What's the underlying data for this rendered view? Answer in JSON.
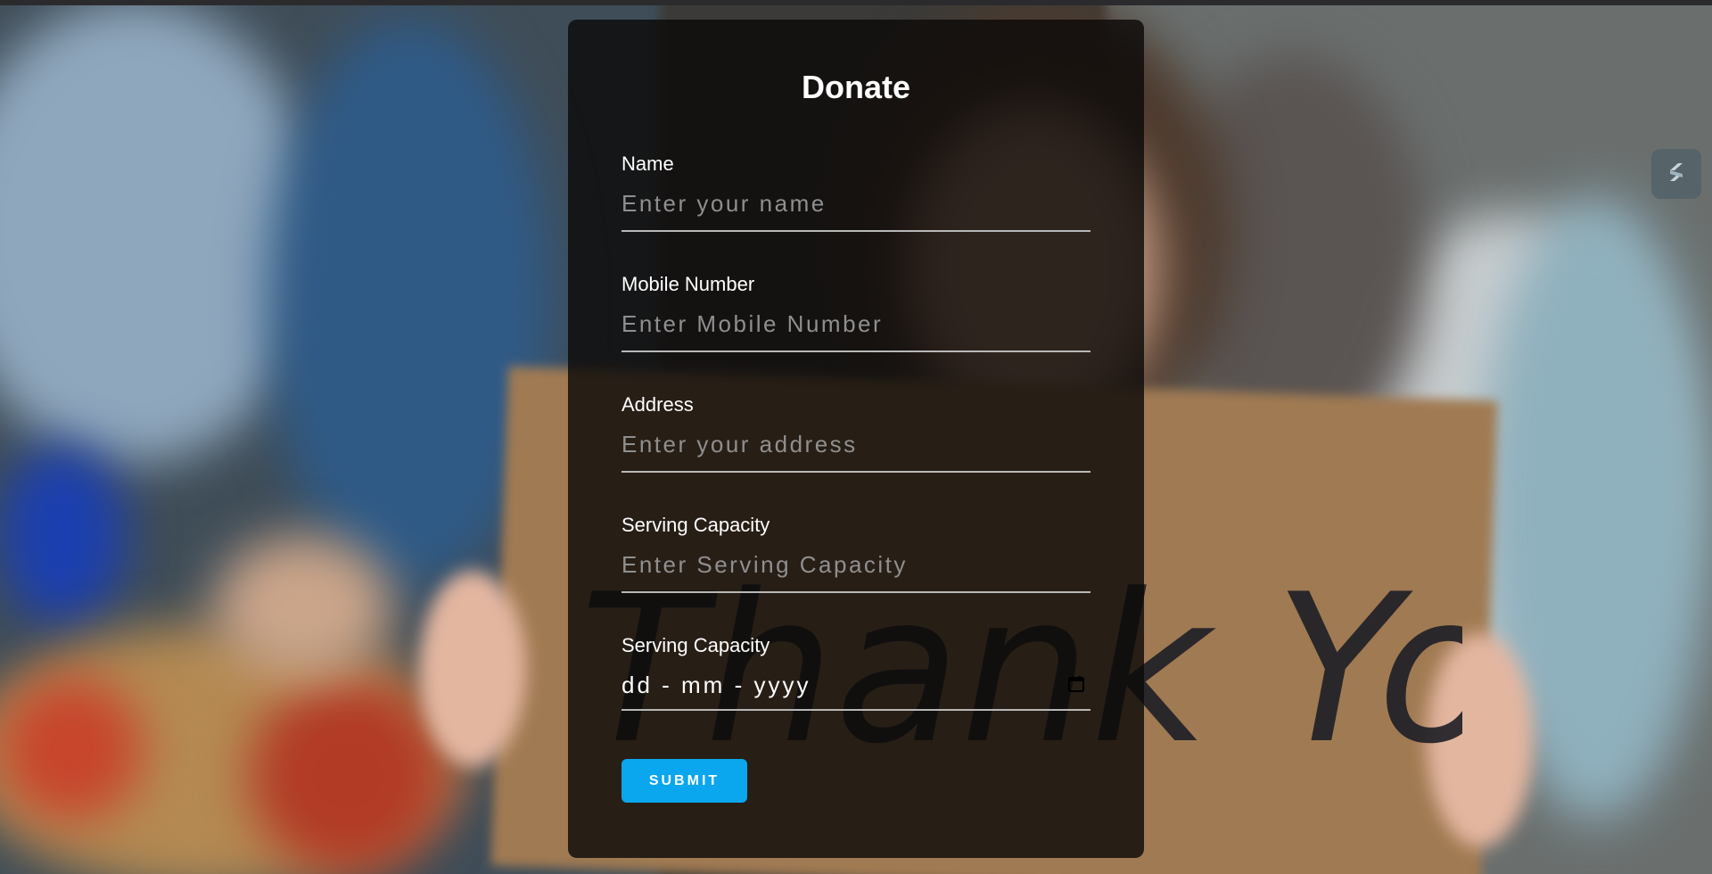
{
  "form": {
    "title": "Donate",
    "fields": [
      {
        "label": "Name",
        "placeholder": "Enter your name"
      },
      {
        "label": "Mobile Number",
        "placeholder": "Enter Mobile Number"
      },
      {
        "label": "Address",
        "placeholder": "Enter your address"
      },
      {
        "label": "Serving Capacity",
        "placeholder": "Enter Serving Capacity"
      },
      {
        "label": "Serving Capacity",
        "value": "dd - mm - yyyy"
      }
    ],
    "submit_label": "SUBMIT"
  },
  "background": {
    "sign_text": "Thank You"
  },
  "colors": {
    "accent": "#0aa6ee",
    "card_overlay": "#0c0a09"
  },
  "icons": {
    "date_picker": "calendar-icon",
    "floating_widget": "slash-logo-icon"
  }
}
